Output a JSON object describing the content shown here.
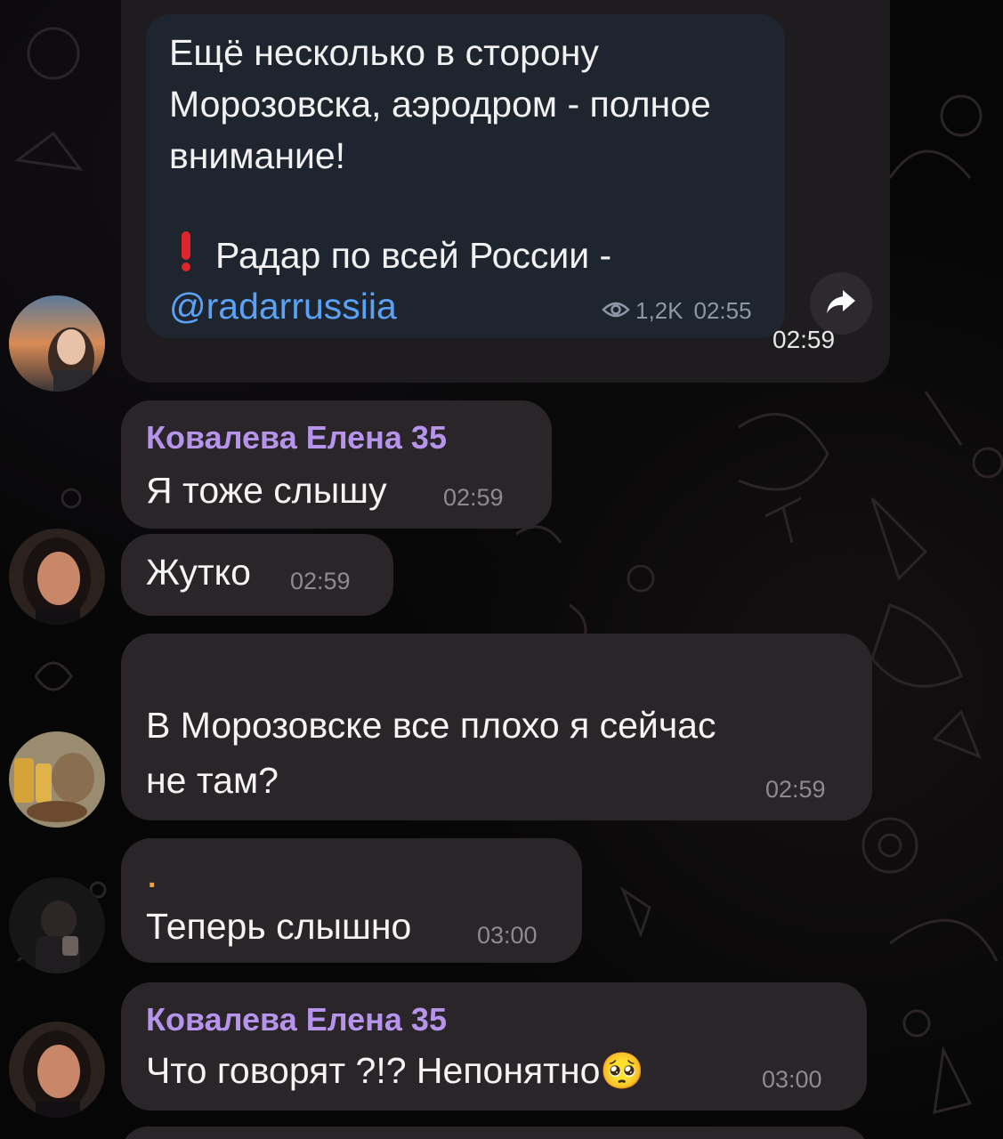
{
  "forwarded": {
    "text_lines": [
      "Ещё несколько в сторону",
      "Морозовска, аэродром - полное",
      "внимание!"
    ],
    "radar_label": "Радар по всей России -",
    "link": "@radarrussiia",
    "views": "1,2K",
    "time": "02:55",
    "outer_time": "02:59",
    "exclamation_icon": "red-exclamation-icon",
    "share_icon": "share-arrow-icon"
  },
  "messages": [
    {
      "sender": "Ковалева Елена 35",
      "text": "Я тоже слышу",
      "time": "02:59"
    },
    {
      "sender": "",
      "text": "Жутко",
      "time": "02:59"
    },
    {
      "sender": "",
      "text_lines": [
        "В Морозовске все плохо я сейчас",
        "не там?"
      ],
      "time": "02:59"
    },
    {
      "sender": ".",
      "text": "Теперь слышно",
      "time": "03:00"
    },
    {
      "sender": "Ковалева Елена 35",
      "text": "Что говорят ?!? Непонятно",
      "emoji": "🥺",
      "time": "03:00"
    }
  ],
  "colors": {
    "sender_name": "#b694ec",
    "sender_dot": "#f0a040",
    "link": "#5aa2f5",
    "bubble": "#2a2529"
  }
}
